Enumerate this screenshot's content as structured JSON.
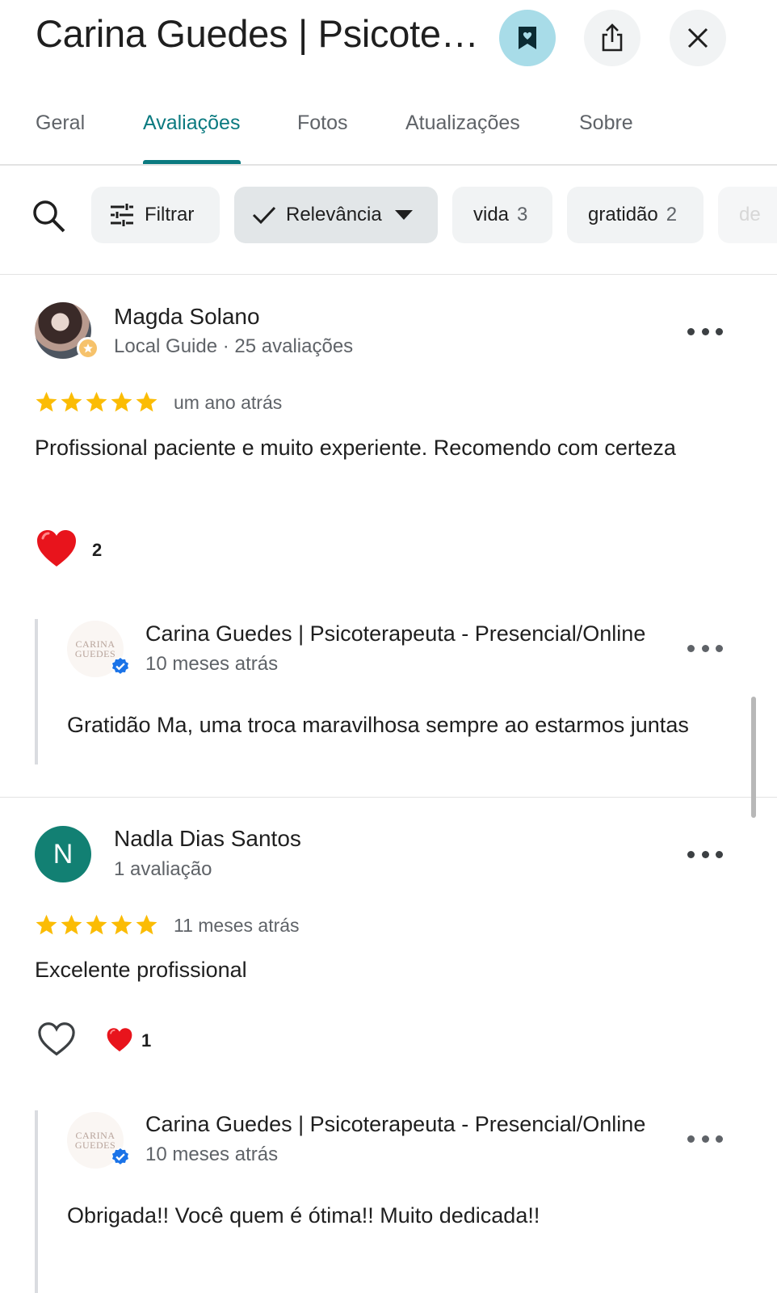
{
  "header": {
    "title": "Carina Guedes | Psicoterapeuta - Presencial/Online",
    "buttons": [
      "bookmark-icon",
      "share-icon",
      "close-icon"
    ]
  },
  "tabs": [
    {
      "label": "Geral"
    },
    {
      "label": "Avaliações",
      "active": true
    },
    {
      "label": "Fotos"
    },
    {
      "label": "Atualizações"
    },
    {
      "label": "Sobre"
    }
  ],
  "filters": {
    "filter_label": "Filtrar",
    "sort_label": "Relevância",
    "chips": [
      {
        "label": "vida",
        "count": "3"
      },
      {
        "label": "gratidão",
        "count": "2"
      },
      {
        "label": "de",
        "count": ""
      }
    ]
  },
  "colors": {
    "accent": "#0b7a80",
    "star": "#fbbc04",
    "heart": "#e8141c",
    "avatar_letter_bg": "#128073"
  },
  "reviews": [
    {
      "name": "Magda Solano",
      "subtitle": "Local Guide · 25 avaliações",
      "rating": 5,
      "time": "um ano atrás",
      "text": "Profissional paciente e muito experiente.  Recomendo com certeza",
      "reactions": {
        "heart_count": "2"
      },
      "reply": {
        "name": "Carina Guedes | Psicoterapeuta - Presencial/Online",
        "time": "10 meses atrás",
        "text": "Gratidão Ma, uma troca maravilhosa sempre ao estarmos juntas"
      }
    },
    {
      "name": "Nadla Dias Santos",
      "initial": "N",
      "subtitle": "1 avaliação",
      "rating": 5,
      "time": "11 meses atrás",
      "text": "Excelente profissional",
      "reactions": {
        "heart_count": "1"
      },
      "reply": {
        "name": "Carina Guedes | Psicoterapeuta - Presencial/Online",
        "time": "10 meses atrás",
        "text": "Obrigada!! Você quem é ótima!! Muito dedicada!!"
      }
    }
  ],
  "owner_logo": {
    "line1": "CARINA",
    "line2": "GUEDES"
  }
}
